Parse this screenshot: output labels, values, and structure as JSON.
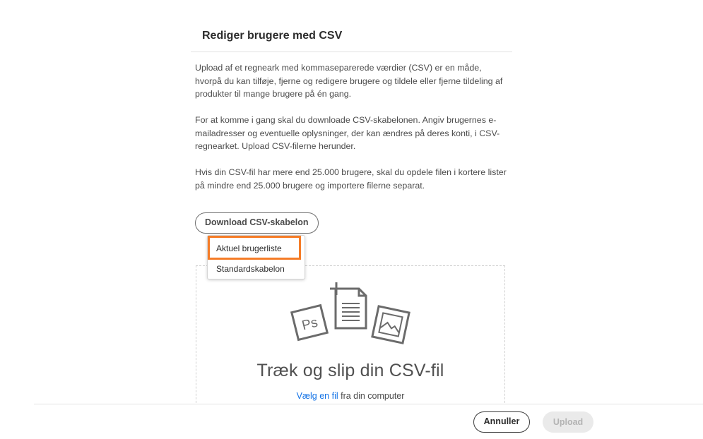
{
  "dialog": {
    "title": "Rediger brugere med CSV",
    "paragraphs": [
      "Upload af et regneark med kommaseparerede værdier (CSV) er en måde, hvorpå du kan tilføje, fjerne og redigere brugere og tildele eller fjerne tildeling af produkter til mange brugere på én gang.",
      "For at komme i gang skal du downloade CSV-skabelonen. Angiv brugernes e-mailadresser og eventuelle oplysninger, der kan ændres på deres konti, i CSV-regnearket. Upload CSV-filerne herunder.",
      "Hvis din CSV-fil har mere end 25.000 brugere, skal du opdele filen i kortere lister på mindre end 25.000 brugere og importere filerne separat."
    ],
    "download_button_label": "Download CSV-skabelon",
    "download_menu": {
      "items": [
        {
          "label": "Aktuel brugerliste",
          "highlighted": true
        },
        {
          "label": "Standardskabelon",
          "highlighted": false
        }
      ]
    },
    "dropzone": {
      "headline": "Træk og slip din CSV-fil",
      "link_label": "Vælg en fil",
      "sub_text": " fra din computer",
      "icons": [
        "photoshop-file-icon",
        "add-document-icon",
        "image-file-icon"
      ]
    },
    "footer": {
      "cancel_label": "Annuller",
      "upload_label": "Upload"
    }
  },
  "colors": {
    "highlight": "#f57c27",
    "link": "#1473e6",
    "disabled_button_bg": "#eaeaea"
  }
}
